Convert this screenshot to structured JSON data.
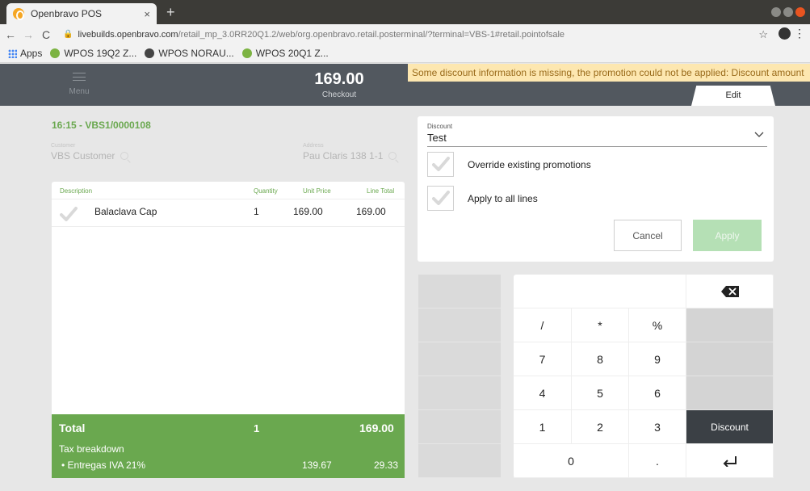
{
  "browser": {
    "tab_title": "Openbravo POS",
    "tab_close": "×",
    "new_tab": "+",
    "url_host": "livebuilds.openbravo.com",
    "url_path": "/retail_mp_3.0RR20Q1.2/web/org.openbravo.retail.posterminal/?terminal=VBS-1#retail.pointofsale",
    "bookmarks": [
      "Apps",
      "WPOS 19Q2 Z...",
      "WPOS NORAU...",
      "WPOS 20Q1 Z..."
    ]
  },
  "topbar": {
    "menu_label": "Menu",
    "checkout_amount": "169.00",
    "checkout_label": "Checkout",
    "edit_tab": "Edit"
  },
  "warning": "Some discount information is missing, the promotion could not be applied: Discount amount",
  "ticket": {
    "title": "16:15 - VBS1/0000108",
    "customer_label": "Customer",
    "customer_value": "VBS Customer",
    "address_label": "Address",
    "address_value": "Pau Claris 138 1-1",
    "columns": {
      "description": "Description",
      "quantity": "Quantity",
      "unit_price": "Unit Price",
      "line_total": "Line Total"
    },
    "lines": [
      {
        "description": "Balaclava Cap",
        "quantity": "1",
        "unit_price": "169.00",
        "line_total": "169.00"
      }
    ],
    "total_label": "Total",
    "total_qty": "1",
    "total_amount": "169.00",
    "tax_breakdown_label": "Tax breakdown",
    "tax_line_label": "• Entregas IVA 21%",
    "tax_line_base": "139.67",
    "tax_line_amount": "29.33"
  },
  "discount": {
    "label": "Discount",
    "value": "Test",
    "override_label": "Override existing promotions",
    "apply_all_label": "Apply to all lines",
    "cancel": "Cancel",
    "apply": "Apply"
  },
  "keypad": {
    "slash": "/",
    "star": "*",
    "percent": "%",
    "k7": "7",
    "k8": "8",
    "k9": "9",
    "k4": "4",
    "k5": "5",
    "k6": "6",
    "k1": "1",
    "k2": "2",
    "k3": "3",
    "k0": "0",
    "dot": ".",
    "discount": "Discount"
  },
  "colors": {
    "green": "#6aa84f",
    "topbar": "#52585f",
    "warning_bg": "#fde7b0",
    "dark_key": "#3b4045"
  }
}
